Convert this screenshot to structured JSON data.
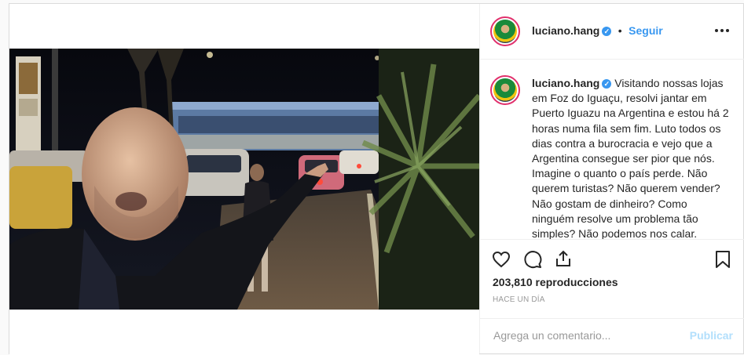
{
  "header": {
    "username": "luciano.hang",
    "separator": "•",
    "follow_label": "Seguir",
    "more_icon": "more-horizontal-icon"
  },
  "caption": {
    "username": "luciano.hang",
    "text": "Visitando nossas lojas em Foz do Iguaçu, resolvi jantar em Puerto Iguazu na Argentina e estou há 2 horas numa fila sem fim. Luto todos os dias contra a burocracia e vejo que a Argentina consegue ser pior que nós. Imagine o quanto o país perde. Não querem turistas? Não querem vender? Não gostam de dinheiro? Como ninguém resolve um problema tão simples? Não podemos nos calar."
  },
  "actions": {
    "like_icon": "heart-icon",
    "comment_icon": "comment-icon",
    "share_icon": "share-icon",
    "save_icon": "bookmark-icon",
    "views": "203,810 reproducciones",
    "time_ago": "HACE UN DÍA"
  },
  "comment_box": {
    "placeholder": "Agrega un comentario...",
    "publish_label": "Publicar"
  },
  "colors": {
    "accent": "#3897f0",
    "border": "#dbdbdb",
    "text": "#262626",
    "muted": "#999999",
    "publish_disabled": "#b2dffc"
  }
}
